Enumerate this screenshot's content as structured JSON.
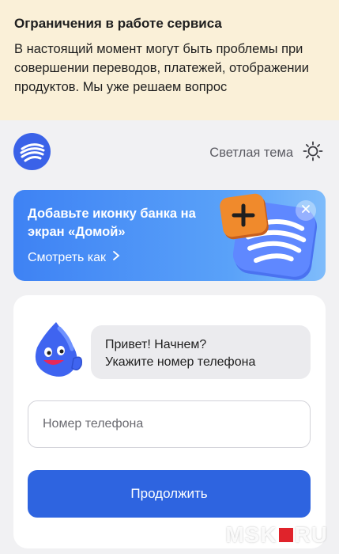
{
  "alert": {
    "title": "Ограничения в работе сервиса",
    "text": "В настоящий момент могут быть проблемы при совершении переводов, платежей, отображении продуктов. Мы уже решаем вопрос"
  },
  "header": {
    "logo_icon": "bank-logo-icon",
    "theme_label": "Светлая тема",
    "theme_icon": "sun-icon"
  },
  "banner": {
    "title": "Добавьте иконку банка на экран «Домой»",
    "link_label": "Смотреть как",
    "colors": {
      "start": "#3e82f4",
      "end": "#7fbcfb",
      "plus_tile": "#f08a2c"
    }
  },
  "login": {
    "greeting_line1": "Привет! Начнем?",
    "greeting_line2": "Укажите номер телефона",
    "phone_placeholder": "Номер телефона",
    "phone_value": "",
    "continue_label": "Продолжить",
    "accent_color": "#2e64e0"
  },
  "watermark": {
    "left": "MSK",
    "right": "RU"
  }
}
